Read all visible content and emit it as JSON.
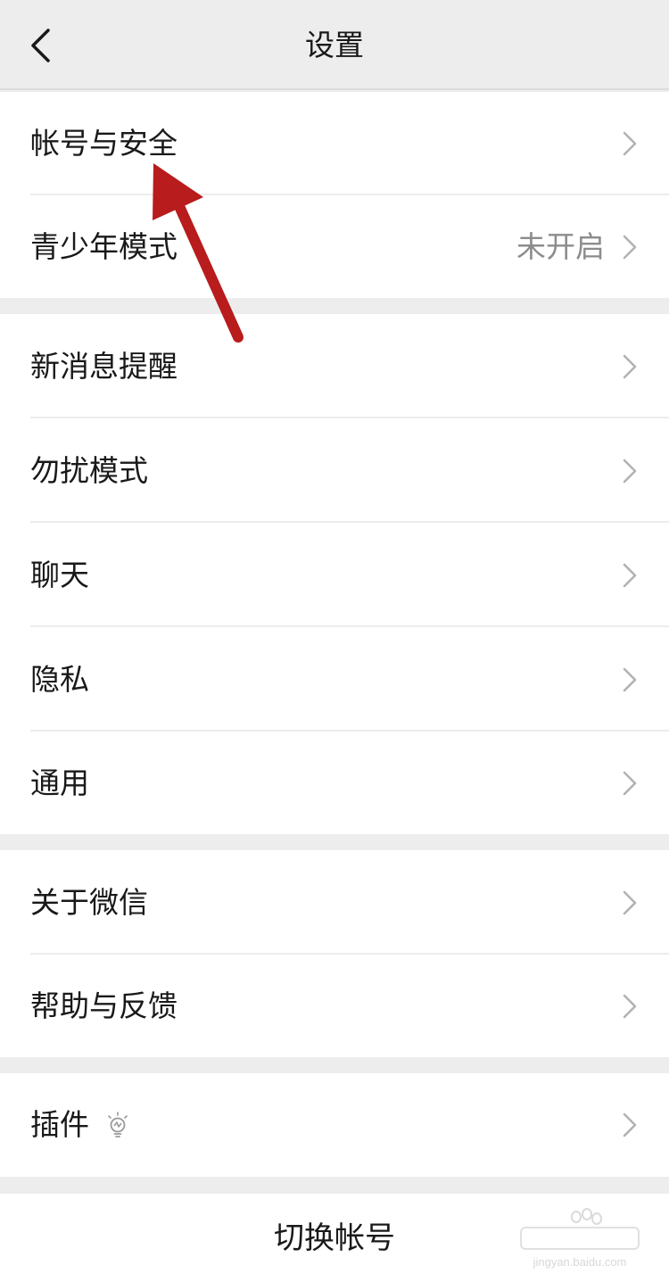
{
  "nav": {
    "title": "设置",
    "back_icon": "chevron-left-icon"
  },
  "groups": [
    {
      "items": [
        {
          "label": "帐号与安全",
          "value": ""
        },
        {
          "label": "青少年模式",
          "value": "未开启"
        }
      ]
    },
    {
      "items": [
        {
          "label": "新消息提醒",
          "value": ""
        },
        {
          "label": "勿扰模式",
          "value": ""
        },
        {
          "label": "聊天",
          "value": ""
        },
        {
          "label": "隐私",
          "value": ""
        },
        {
          "label": "通用",
          "value": ""
        }
      ]
    },
    {
      "items": [
        {
          "label": "关于微信",
          "value": ""
        },
        {
          "label": "帮助与反馈",
          "value": ""
        }
      ]
    },
    {
      "items": [
        {
          "label": "插件",
          "value": "",
          "icon": "lightbulb-icon"
        }
      ]
    }
  ],
  "switch_account": {
    "label": "切换帐号"
  },
  "watermark": {
    "text": "jingyan.baidu.com"
  },
  "colors": {
    "background": "#ededed",
    "row": "#ffffff",
    "text": "#191919",
    "secondary_text": "#8c8c8c",
    "chevron": "#b2b2b2",
    "annotation_arrow": "#b81c1c"
  }
}
